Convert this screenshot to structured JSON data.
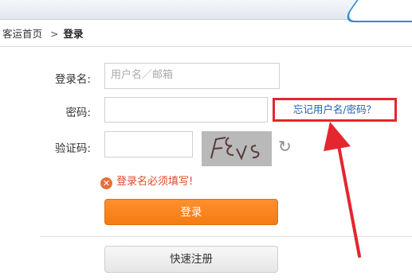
{
  "breadcrumb": {
    "home": "客运首页",
    "separator": ">",
    "current": "登录"
  },
  "form": {
    "username_label": "登录名:",
    "username_placeholder": "用户名／邮箱",
    "password_label": "密码:",
    "captcha_label": "验证码:",
    "forgot_link": "忘记用户名/密码？",
    "error_message": "登录名必须填写!",
    "login_button": "登录",
    "register_button": "快速注册"
  },
  "captcha_text": "FEvs",
  "icons": {
    "refresh": "refresh-icon",
    "error": "error-icon"
  },
  "colors": {
    "accent": "#f57b12",
    "error": "#e04a2a",
    "link": "#1f5fb2",
    "annotation": "#e4262f"
  }
}
